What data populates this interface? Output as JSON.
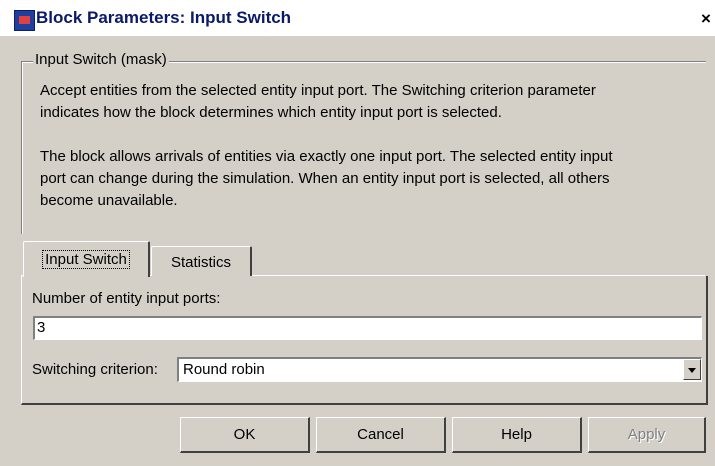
{
  "window": {
    "title": "Block Parameters: Input Switch",
    "close_glyph": "×"
  },
  "group": {
    "title": "Input Switch  (mask)",
    "description_1": [
      "Accept entities from the selected entity input port. The Switching criterion parameter",
      "indicates how the block determines which entity input port is selected."
    ],
    "description_2": [
      "The block allows arrivals of entities via exactly one input port. The selected entity input",
      "port can change during the simulation. When an entity input port is selected, all others",
      "become unavailable."
    ]
  },
  "tabs": [
    {
      "label": "Input Switch",
      "active": true
    },
    {
      "label": "Statistics",
      "active": false
    }
  ],
  "fields": {
    "ports_label": "Number of entity input ports:",
    "ports_value": "3",
    "criterion_label": "Switching criterion:",
    "criterion_value": "Round robin"
  },
  "buttons": {
    "ok": "OK",
    "cancel": "Cancel",
    "help": "Help",
    "apply": "Apply"
  },
  "icons": {
    "app": "simulink-block-icon",
    "close": "close-icon",
    "dropdown": "chevron-down-icon"
  }
}
